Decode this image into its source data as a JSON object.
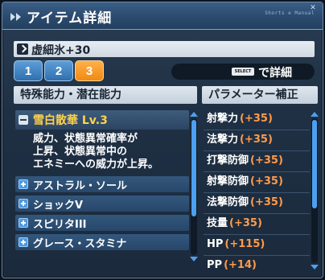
{
  "window": {
    "title": "アイテム詳細",
    "tag": "Shorts e Manual",
    "close": "✕"
  },
  "item": {
    "name": "虚細氷+30"
  },
  "tabs": [
    {
      "label": "1",
      "active": false
    },
    {
      "label": "2",
      "active": false
    },
    {
      "label": "3",
      "active": true
    }
  ],
  "detail": {
    "key": "SELECT",
    "label": "で詳細"
  },
  "left_panel": {
    "header": "特殊能力・潜在能力",
    "expanded": {
      "name": "雪白散華 Lv.3",
      "description": [
        "威力、状態異常確率が",
        "上昇、状態異常中の",
        "エネミーへの威力が上昇。"
      ]
    },
    "abilities": [
      "アストラル・ソール",
      "ショックV",
      "スピリタIII",
      "グレース・スタミナ"
    ]
  },
  "right_panel": {
    "header": "パラメーター補正",
    "stats": [
      {
        "name": "射撃力",
        "value": "(+35)"
      },
      {
        "name": "法撃力",
        "value": "(+35)"
      },
      {
        "name": "打撃防御",
        "value": "(+35)"
      },
      {
        "name": "射撃防御",
        "value": "(+35)"
      },
      {
        "name": "法撃防御",
        "value": "(+35)"
      },
      {
        "name": "技量",
        "value": "(+35)"
      },
      {
        "name": "HP",
        "value": "(+115)"
      },
      {
        "name": "PP",
        "value": "(+14)"
      }
    ]
  },
  "colors": {
    "accent_orange": "#f08a14",
    "tab_blue": "#2f6fae",
    "highlight_yellow": "#ffd34a",
    "stat_value": "#ff9b4a"
  }
}
